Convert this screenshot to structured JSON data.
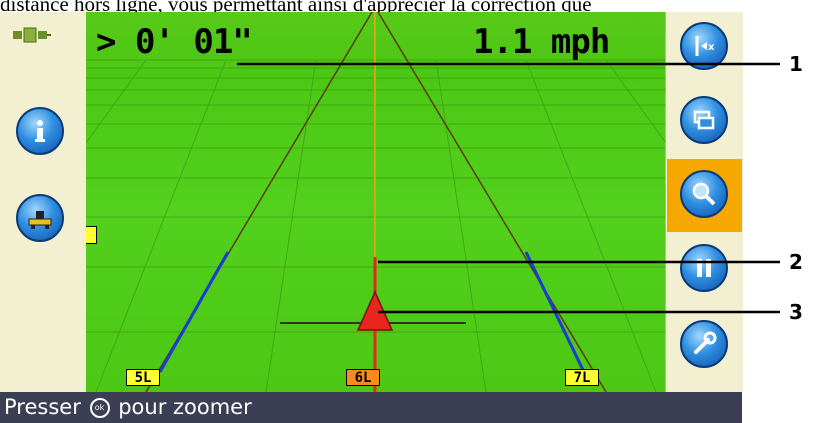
{
  "document": {
    "text_above": "distance hors ligne, vous permettant ainsi d'apprécier la correction que"
  },
  "display": {
    "offline_distance": "> 0' 01\"",
    "speed": "1.1 mph",
    "status_message_before": "Presser",
    "status_message_icon": "ok",
    "status_message_after": "pour zoomer"
  },
  "left_panel": {
    "items": [
      {
        "name": "gps-status-icon"
      },
      {
        "name": "info-icon"
      },
      {
        "name": "implement-icon"
      }
    ]
  },
  "right_panel": {
    "items": [
      {
        "name": "nudge-icon"
      },
      {
        "name": "view-toggle-icon"
      },
      {
        "name": "zoom-icon",
        "selected": true
      },
      {
        "name": "pause-icon"
      },
      {
        "name": "settings-wrench-icon"
      }
    ],
    "selected_color": "#f7a800"
  },
  "swaths": {
    "left": "5L",
    "current": "6L",
    "right": "7L"
  },
  "callouts": [
    "1",
    "2",
    "3"
  ],
  "colors": {
    "field": "#4cc814",
    "guidance_line": "#e8251f",
    "swath_line": "#1a3bd6",
    "status_bar": "#3c3f54",
    "panel": "#f2f0d0"
  }
}
